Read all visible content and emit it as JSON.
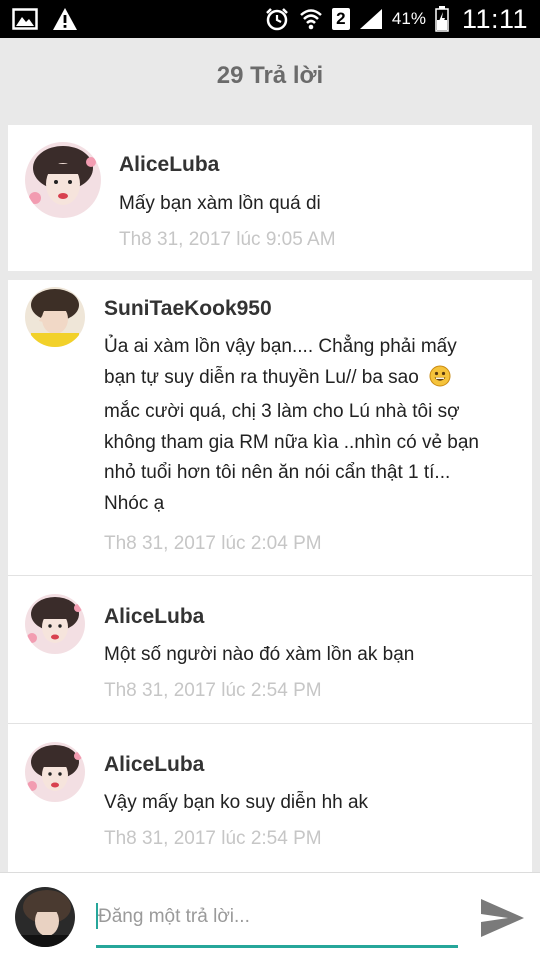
{
  "status_bar": {
    "battery_percent": "41%",
    "time": "11:11",
    "sim_label": "2",
    "icons": [
      "image-icon",
      "warning-icon",
      "alarm-icon",
      "wifi-icon",
      "sim-icon",
      "signal-icon",
      "battery-icon"
    ]
  },
  "header": {
    "title": "29 Trả lời"
  },
  "main_comment": {
    "author": "AliceLuba",
    "text": "Mấy bạn xàm lồn quá di",
    "timestamp": "Th8 31, 2017 lúc 9:05 AM"
  },
  "replies": [
    {
      "author": "SuniTaeKook950",
      "lines": [
        "Ủa ai xàm lồn vậy bạn.... Chẳng phải mấy",
        "bạn tự suy diễn ra thuyền Lu// ba sao",
        "mắc cười quá, chị 3 làm cho Lú nhà tôi sợ",
        "không tham gia RM nữa kìa ..nhìn có vẻ bạn",
        "nhỏ tuổi hơn tôi nên ăn nói cẩn thật 1 tí...",
        "Nhóc ạ"
      ],
      "timestamp": "Th8 31, 2017 lúc 2:04 PM"
    },
    {
      "author": "AliceLuba",
      "lines": [
        "Một số người nào đó xàm lồn ak bạn"
      ],
      "timestamp": "Th8 31, 2017 lúc 2:54 PM"
    },
    {
      "author": "AliceLuba",
      "lines": [
        "Vậy mấy bạn ko suy diễn hh ak"
      ],
      "timestamp": "Th8 31, 2017 lúc 2:54 PM"
    }
  ],
  "compose": {
    "placeholder": "Đăng một trả lời...",
    "value": ""
  },
  "colors": {
    "accent": "#26a69a",
    "background": "#e9e9e9",
    "timestamp": "#c6c6c6"
  }
}
